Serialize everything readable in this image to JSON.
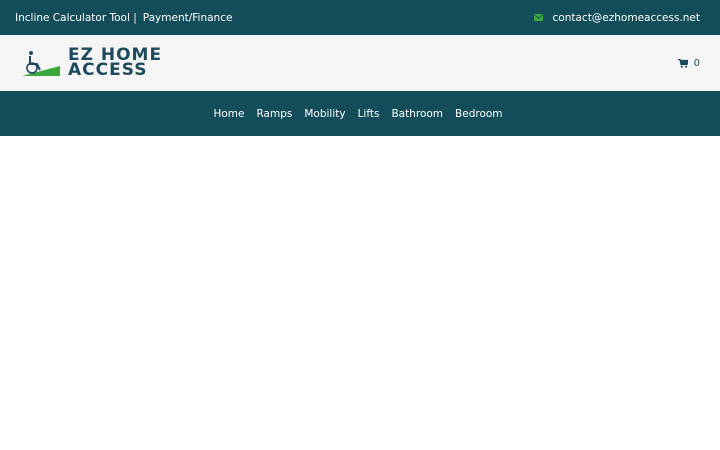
{
  "topbar": {
    "calculator_link": "Incline Calculator Tool |",
    "payment_link": "Payment/Finance",
    "email": "contact@ezhomeaccess.net",
    "email_icon": "envelope-icon"
  },
  "header": {
    "logo_line1": "EZ HOME",
    "logo_line2": "ACCESS",
    "cart_count": "0",
    "cart_icon": "cart-icon"
  },
  "nav": {
    "items": [
      "Home",
      "Ramps",
      "Mobility",
      "Lifts",
      "Bathroom",
      "Bedroom"
    ]
  },
  "colors": {
    "topbar_bg": "#134d5a",
    "nav_bg": "#134d5a",
    "header_bg": "#f5f5f5",
    "accent_green": "#3aa83a",
    "logo_text": "#1e4a5e"
  }
}
